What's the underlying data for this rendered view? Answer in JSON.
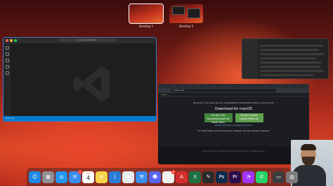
{
  "spaces": [
    {
      "label": "Desktop 1",
      "active": true
    },
    {
      "label": "Desktop 2",
      "active": false
    }
  ],
  "vscode": {
    "command_center": "vsdk_project(bsl)",
    "status_text": "⊗ 0 ⚠ 0",
    "accent": "#007acc"
  },
  "browser": {
    "url": "nodejs.org",
    "site_nav": "node",
    "intro": "Node.js® is an open-source, cross-platform JavaScript runtime environment.",
    "download_title": "Download for macOS",
    "lts_version": "18.18.0 LTS",
    "lts_sub": "Recommended For Most Users",
    "current_version": "20.8.0 Current",
    "current_sub": "Latest Features",
    "links": "Other Downloads | Changelog | API Docs",
    "other_info": "For information about supported releases, see the release schedule.",
    "footer": "Copyright OpenJS Foundation and Node.js contributors. All rights reserved."
  },
  "dock": {
    "calendar_month": "OCT",
    "calendar_day": "4",
    "apps": [
      {
        "name": "finder-icon",
        "glyph": "☺",
        "color": "#1e88e5"
      },
      {
        "name": "launchpad-icon",
        "glyph": "▦",
        "color": "#8e8e93"
      },
      {
        "name": "safari-icon",
        "glyph": "◎",
        "color": "#2196f3"
      },
      {
        "name": "mail-icon",
        "glyph": "✉",
        "color": "#3b8df1",
        "badge": "2"
      },
      {
        "name": "calendar-icon",
        "glyph": "",
        "color": "#ffffff"
      },
      {
        "name": "notes-icon",
        "glyph": "≡",
        "color": "#f7d44c"
      },
      {
        "name": "vscode-icon",
        "glyph": "⟩",
        "color": "#2a7bd6"
      },
      {
        "name": "chrome-icon",
        "glyph": "◉",
        "color": "#e8eaed"
      },
      {
        "name": "xcode-icon",
        "glyph": "⚒",
        "color": "#3a8ef0"
      },
      {
        "name": "discord-icon",
        "glyph": "☻",
        "color": "#5865f2"
      },
      {
        "name": "photos-icon",
        "glyph": "✿",
        "color": "#f0f0f0",
        "badge": "6"
      },
      {
        "name": "acrobat-icon",
        "glyph": "A",
        "color": "#d32f2f"
      },
      {
        "name": "excel-icon",
        "glyph": "X",
        "color": "#1d7044"
      },
      {
        "name": "figma-icon",
        "glyph": "✎",
        "color": "#2b2b2b"
      },
      {
        "name": "photoshop-icon",
        "glyph": "Ps",
        "color": "#0b2a4a"
      },
      {
        "name": "premiere-icon",
        "glyph": "Pr",
        "color": "#2a0f4a"
      },
      {
        "name": "messenger-icon",
        "glyph": "◔",
        "color": "#a033ff"
      },
      {
        "name": "whatsapp-icon",
        "glyph": "✆",
        "color": "#25d366"
      },
      {
        "name": "preview-icon",
        "glyph": "▭",
        "color": "#3c3c3c"
      },
      {
        "name": "trash-icon",
        "glyph": "▥",
        "color": "#7b7b7b"
      }
    ]
  }
}
